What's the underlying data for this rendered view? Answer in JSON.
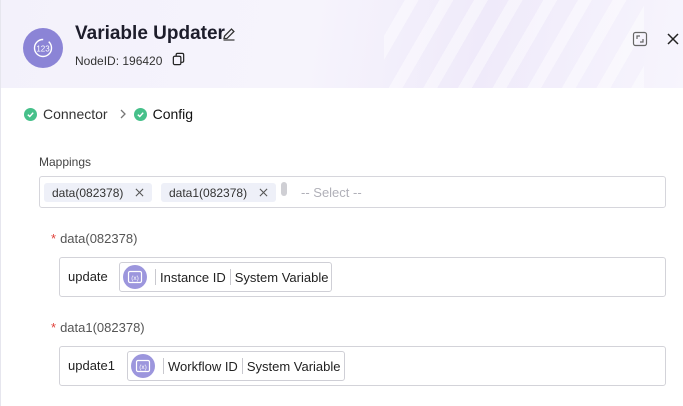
{
  "header": {
    "title": "Variable Updater",
    "node_id_label": "NodeID: 196420",
    "icons": {
      "node": "calculator-icon",
      "edit": "pencil-icon",
      "copy": "copy-icon",
      "fullscreen": "fullscreen-icon",
      "close": "close-icon"
    }
  },
  "steps": [
    {
      "label": "Connector",
      "status": "done"
    },
    {
      "label": "Config",
      "status": "active"
    }
  ],
  "mappings": {
    "label": "Mappings",
    "tags": [
      "data(082378)",
      "data1(082378)"
    ],
    "placeholder": "-- Select --"
  },
  "fields": [
    {
      "label": "data(082378)",
      "required": true,
      "value": "update",
      "variable": {
        "name": "Instance ID",
        "type": "System Variable"
      }
    },
    {
      "label": "data1(082378)",
      "required": true,
      "value": "update1",
      "variable": {
        "name": "Workflow ID",
        "type": "System Variable"
      }
    }
  ],
  "colors": {
    "accent": "#8b84d6",
    "success": "#46c08a",
    "required": "#e0413b"
  }
}
